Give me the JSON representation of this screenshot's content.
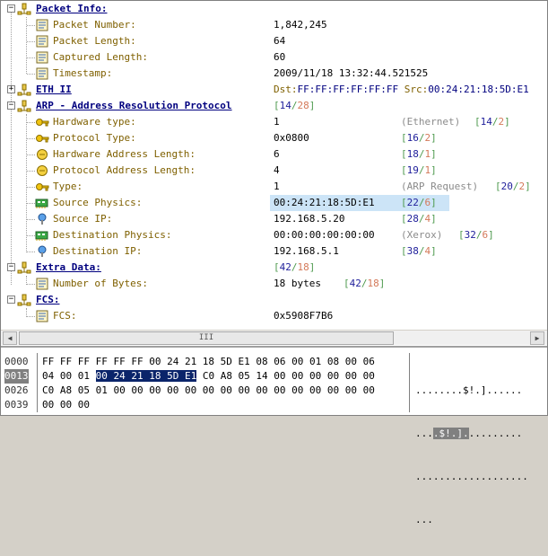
{
  "tree": {
    "packet_info": {
      "title": "Packet Info:",
      "fields": [
        {
          "label": "Packet Number:",
          "value": "1,842,245"
        },
        {
          "label": "Packet Length:",
          "value": "64"
        },
        {
          "label": "Captured Length:",
          "value": "60"
        },
        {
          "label": "Timestamp:",
          "value": "2009/11/18 13:32:44.521525"
        }
      ]
    },
    "eth": {
      "title": "ETH II",
      "dst_key": "Dst:",
      "dst_val": "FF:FF:FF:FF:FF:FF",
      "src_key": "Src:",
      "src_val": "00:24:21:18:5D:E1"
    },
    "arp": {
      "title": "ARP - Address Resolution Protocol",
      "range_open": "[",
      "range_start": "14",
      "range_sep": "/",
      "range_len": "28",
      "range_close": "]",
      "fields": [
        {
          "label": "Hardware type:",
          "value": "1",
          "note": "(Ethernet)",
          "off": "14",
          "len": "2"
        },
        {
          "label": "Protocol Type:",
          "value": "0x0800",
          "note": "",
          "off": "16",
          "len": "2"
        },
        {
          "label": "Hardware Address Length:",
          "value": "6",
          "note": "",
          "off": "18",
          "len": "1"
        },
        {
          "label": "Protocol Address Length:",
          "value": "4",
          "note": "",
          "off": "19",
          "len": "1"
        },
        {
          "label": "Type:",
          "value": "1",
          "note": "(ARP Request)",
          "off": "20",
          "len": "2"
        },
        {
          "label": "Source Physics:",
          "value": "00:24:21:18:5D:E1",
          "note": "",
          "off": "22",
          "len": "6"
        },
        {
          "label": "Source IP:",
          "value": "192.168.5.20",
          "note": "",
          "off": "28",
          "len": "4"
        },
        {
          "label": "Destination Physics:",
          "value": "00:00:00:00:00:00",
          "note": "(Xerox)",
          "off": "32",
          "len": "6"
        },
        {
          "label": "Destination IP:",
          "value": "192.168.5.1",
          "note": "",
          "off": "38",
          "len": "4"
        }
      ]
    },
    "extra": {
      "title": "Extra Data:",
      "range_start": "42",
      "range_len": "18",
      "fields": [
        {
          "label": "Number of Bytes:",
          "value": "18 bytes",
          "off": "42",
          "len": "18"
        }
      ]
    },
    "fcs": {
      "title": "FCS:",
      "fields": [
        {
          "label": "FCS:",
          "value": "0x5908F7B6"
        }
      ]
    }
  },
  "scrollbar": {
    "left_arrow": "◀",
    "right_arrow": "▶",
    "thumb_grip": "III"
  },
  "hex": {
    "offsets": [
      "0000",
      "0013",
      "0026",
      "0039"
    ],
    "selected_offset_index": 1,
    "rows": [
      {
        "pre": "FF FF FF FF FF FF 00 24 21 18 5D E1 08 06 00 01 08 00 06",
        "sel": "",
        "post": ""
      },
      {
        "pre": "04 00 01 ",
        "sel": "00 24 21 18 5D E1",
        "post": " C0 A8 05 14 00 00 00 00 00 00"
      },
      {
        "pre": "C0 A8 05 01 00 00 00 00 00 00 00 00 00 00 00 00 00 00 00",
        "sel": "",
        "post": ""
      },
      {
        "pre": "00 00 00",
        "sel": "",
        "post": ""
      }
    ],
    "ascii": [
      {
        "pre": "........$!.]......",
        "sel": "",
        "post": ""
      },
      {
        "pre": "...",
        "sel": ".$!.].",
        "post": "........."
      },
      {
        "pre": "...................",
        "sel": "",
        "post": ""
      },
      {
        "pre": "...",
        "sel": "",
        "post": ""
      }
    ]
  },
  "colors": {
    "selection": "#0a246a",
    "row_highlight": "#cce4f7",
    "section_title": "#00007f",
    "field_label": "#7f6000"
  }
}
